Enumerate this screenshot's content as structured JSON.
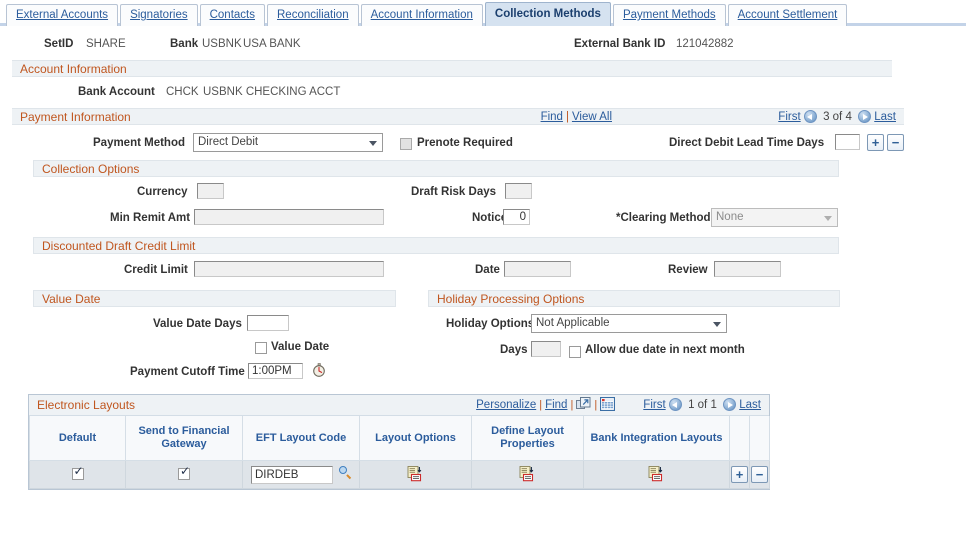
{
  "tabs": [
    {
      "label": "External Accounts",
      "active": false
    },
    {
      "label": "Signatories",
      "active": false
    },
    {
      "label": "Contacts",
      "active": false
    },
    {
      "label": "Reconciliation",
      "active": false
    },
    {
      "label": "Account Information",
      "active": false
    },
    {
      "label": "Collection Methods",
      "active": true
    },
    {
      "label": "Payment Methods",
      "active": false
    },
    {
      "label": "Account Settlement",
      "active": false
    }
  ],
  "header": {
    "setid_label": "SetID",
    "setid_value": "SHARE",
    "bank_label": "Bank",
    "bank_code": "USBNK",
    "bank_name": "USA BANK",
    "external_bank_id_label": "External Bank ID",
    "external_bank_id_value": "121042882"
  },
  "account_information": {
    "section_title": "Account Information",
    "bank_account_label": "Bank Account",
    "bank_account_code": "CHCK",
    "bank_account_name": "USBNK CHECKING ACCT"
  },
  "payment_information": {
    "section_title": "Payment Information",
    "find_label": "Find",
    "view_all_label": "View All",
    "first_label": "First",
    "last_label": "Last",
    "counter": "3 of 4",
    "payment_method_label": "Payment Method",
    "payment_method_value": "Direct Debit",
    "payment_method_options": [
      "Direct Debit"
    ],
    "prenote_label": "Prenote Required",
    "prenote_checked": false,
    "lead_time_label": "Direct Debit Lead Time Days",
    "lead_time_value": "",
    "add_button_label": "+",
    "delete_button_label": "−"
  },
  "collection_options": {
    "section_title": "Collection Options",
    "currency_label": "Currency",
    "currency_value": "",
    "min_remit_label": "Min Remit Amt",
    "min_remit_value": "",
    "draft_risk_label": "Draft Risk Days",
    "draft_risk_value": "",
    "notice_label": "Notice",
    "notice_value": "0",
    "clearing_method_label": "*Clearing Method",
    "clearing_method_value": "None",
    "clearing_method_options": [
      "None"
    ]
  },
  "discounted_draft": {
    "section_title": "Discounted Draft Credit Limit",
    "credit_limit_label": "Credit Limit",
    "credit_limit_value": "",
    "date_label": "Date",
    "date_value": "",
    "review_label": "Review",
    "review_value": ""
  },
  "value_date": {
    "section_title": "Value Date",
    "value_date_days_label": "Value Date Days",
    "value_date_days_value": "",
    "value_date_cb_label": "Value Date",
    "value_date_cb_checked": false,
    "cutoff_label": "Payment Cutoff Time",
    "cutoff_value": "1:00PM",
    "clock_icon": "clock-icon"
  },
  "holiday_processing": {
    "section_title": "Holiday Processing Options",
    "holiday_options_label": "Holiday Options",
    "holiday_options_value": "Not Applicable",
    "holiday_options_list": [
      "Not Applicable"
    ],
    "days_label": "Days",
    "days_value": "",
    "allow_due_date_label": "Allow due date in next month",
    "allow_due_date_checked": false
  },
  "electronic_layouts": {
    "section_title": "Electronic Layouts",
    "personalize_label": "Personalize",
    "find_label": "Find",
    "newwin_icon": "new-window-icon",
    "grid_icon": "download-spreadsheet-icon",
    "first_label": "First",
    "last_label": "Last",
    "counter": "1 of 1",
    "columns": [
      "Default",
      "Send to Financial Gateway",
      "EFT Layout Code",
      "Layout Options",
      "Define Layout Properties",
      "Bank Integration Layouts"
    ],
    "rows": [
      {
        "default_checked": true,
        "send_to_fg_checked": true,
        "eft_layout_code": "DIRDEB",
        "lookup_icon": "magnifier-icon",
        "layout_options_icon": "document-drilldown-icon",
        "define_layout_properties_icon": "document-drilldown-icon",
        "bank_integration_layouts_icon": "document-drilldown-icon",
        "add_button_label": "+",
        "delete_button_label": "−"
      }
    ]
  },
  "colors": {
    "section_title": "#c0561f",
    "link": "#2b5c9c",
    "active_tab_bg": "#d5e2f0",
    "section_bg": "#eef2f5",
    "grid_row_bg": "#dfe4e9"
  }
}
